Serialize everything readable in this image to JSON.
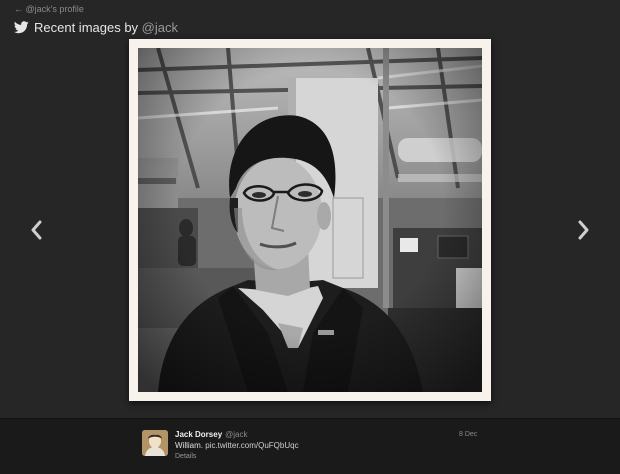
{
  "nav": {
    "back_label": "← @jack's profile"
  },
  "header": {
    "title_prefix": "Recent images by ",
    "handle": "@jack"
  },
  "gallery": {
    "prev_icon": "chevron-left-icon",
    "next_icon": "chevron-right-icon"
  },
  "tweet": {
    "name": "Jack Dorsey",
    "handle": "@jack",
    "text_prefix": "William. ",
    "link": "pic.twitter.com/QuFQbUqc",
    "details_label": "Details",
    "date": "8 Dec"
  },
  "colors": {
    "background": "#262626",
    "bar": "#1a1a1a",
    "frame": "#f7f2ec"
  }
}
